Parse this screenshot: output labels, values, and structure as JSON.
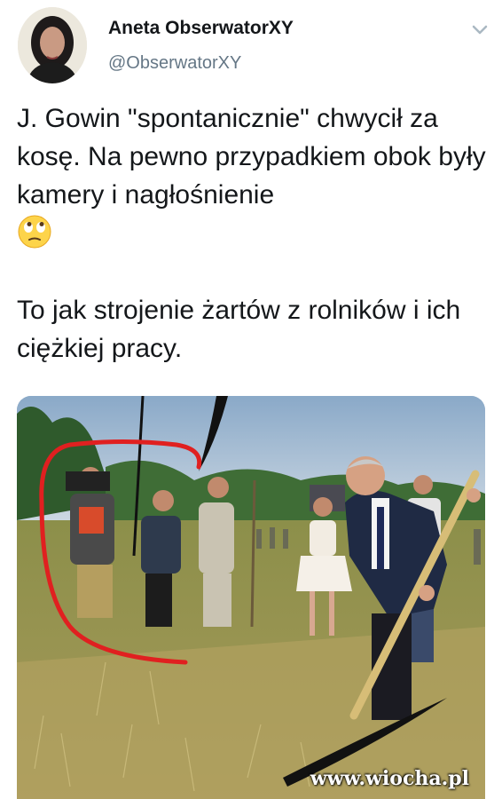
{
  "author": {
    "display_name": "Aneta ObserwatorXY",
    "handle": "@ObserwatorXY"
  },
  "tweet": {
    "paragraph_1": "J. Gowin  \"spontanicznie\" chwycił za kosę. Na pewno przypadkiem obok były kamery i nagłośnienie",
    "paragraph_2": "To jak strojenie żartów z rolników i ich ciężkiej pracy."
  },
  "icons": {
    "menu": "chevron-down-icon",
    "emoji": "face-with-rolling-eyes-icon"
  },
  "media": {
    "watermark": "www.wiocha.pl",
    "highlight_color": "#e02020"
  }
}
